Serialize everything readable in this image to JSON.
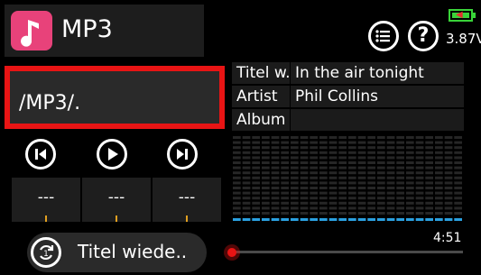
{
  "header": {
    "title": "MP3",
    "app_icon": "music-note-icon",
    "list_button_icon": "list-icon",
    "help_button_icon": "question-mark-icon",
    "help_glyph": "?",
    "battery_voltage": "3.87V",
    "battery_icon": "battery-icon",
    "accent_color": "#e8427a"
  },
  "path": {
    "value": "/MP3/."
  },
  "transport": {
    "prev_icon": "skip-previous-icon",
    "play_icon": "play-icon",
    "next_icon": "skip-next-icon",
    "slots": [
      "---",
      "---",
      "---"
    ]
  },
  "info": {
    "rows": [
      {
        "key": "Titel w.",
        "value": "In the air tonight"
      },
      {
        "key": "Artist",
        "value": "Phil Collins"
      },
      {
        "key": "Album",
        "value": ""
      }
    ]
  },
  "progress": {
    "time": "4:51",
    "position_fraction": 0.0
  },
  "repeat": {
    "label": "Titel wiede..",
    "icon": "repeat-one-icon",
    "icon_digit": "1"
  },
  "colors": {
    "selection": "#e81414",
    "spectrum_bar": "#2aa0e0"
  }
}
